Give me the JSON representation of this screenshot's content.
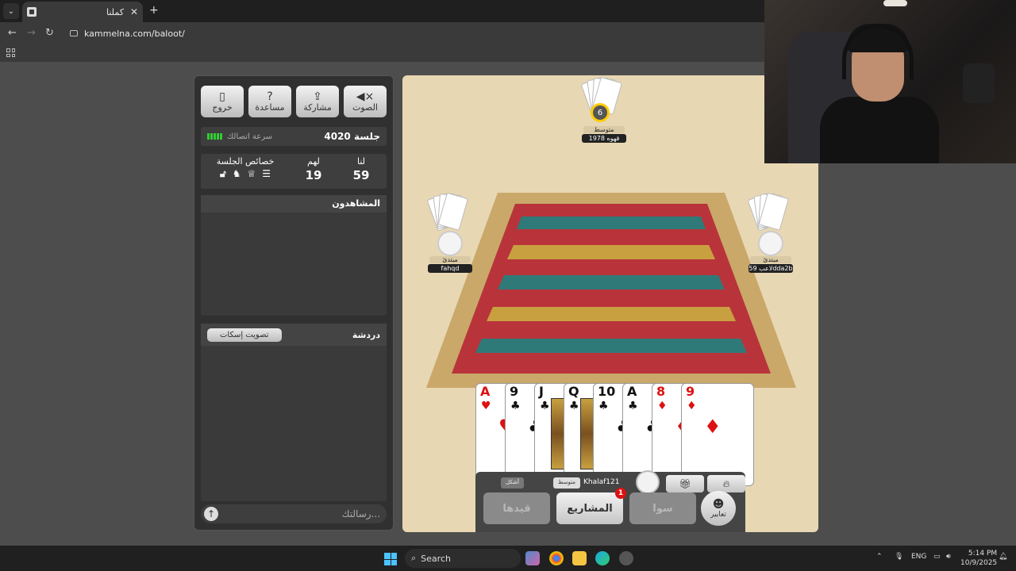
{
  "browser": {
    "tab_title": "كملنا",
    "url": "kammelna.com/baloot/"
  },
  "panel": {
    "buttons": [
      {
        "label": "خروج",
        "icon": "exit-icon"
      },
      {
        "label": "مساعدة",
        "icon": "help-icon"
      },
      {
        "label": "مشاركة",
        "icon": "share-icon"
      },
      {
        "label": "الصوت",
        "icon": "mute-icon"
      }
    ],
    "session_label": "جلسة 4020",
    "connection_label": "سرعة اتصالك",
    "scores": {
      "props_label": "خصائص الجلسة",
      "them_label": "لهم",
      "us_label": "لنا",
      "them_value": "19",
      "us_value": "59"
    },
    "watchers_label": "المشاهدون",
    "chat_label": "دردشة",
    "mute_chat_label": "تصويت إسكات",
    "message_placeholder": "رسالتك..."
  },
  "game": {
    "top_player": {
      "level": "متوسط",
      "name": "قهوه 1978",
      "timer": "6"
    },
    "left_player": {
      "level": "مبتدئ",
      "name": "fahqd"
    },
    "right_player": {
      "level": "مبتدئ",
      "name": "لاعب 59dda2b"
    },
    "hand": [
      {
        "rank": "A",
        "suit": "♥",
        "color": "red"
      },
      {
        "rank": "9",
        "suit": "♣",
        "color": "black"
      },
      {
        "rank": "J",
        "suit": "♣",
        "color": "black"
      },
      {
        "rank": "Q",
        "suit": "♣",
        "color": "black"
      },
      {
        "rank": "10",
        "suit": "♣",
        "color": "black"
      },
      {
        "rank": "A",
        "suit": "♣",
        "color": "black"
      },
      {
        "rank": "8",
        "suit": "♦",
        "color": "red"
      },
      {
        "rank": "9",
        "suit": "♦",
        "color": "red"
      }
    ],
    "self": {
      "name": "Khalaf121",
      "level": "متوسط",
      "chip": "أشكل"
    },
    "actions": {
      "qaydha": "قيدها",
      "projects": "المشاريع",
      "projects_badge": "1",
      "sawa": "سوا",
      "emotes": "تعابير"
    }
  },
  "taskbar": {
    "search": "Search",
    "lang": "ENG",
    "time": "5:14 PM",
    "date": "10/9/2025"
  },
  "colors": {
    "felt": "#e8d7b3",
    "carpet_red": "#b8343a",
    "carpet_border": "#c9a86a"
  }
}
